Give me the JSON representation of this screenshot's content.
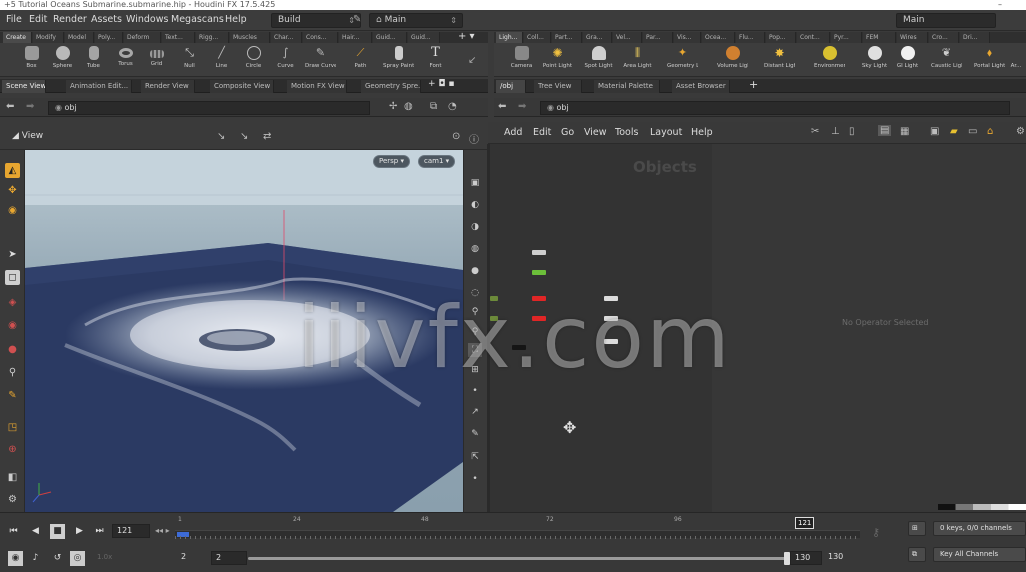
{
  "window": {
    "title": "+5 Tutorial Oceans Submarine.submarine.hip - Houdini FX 17.5.425",
    "minimize": "–"
  },
  "menubar": {
    "items": [
      "File",
      "Edit",
      "Render",
      "Assets",
      "Windows",
      "Megascans",
      "Help"
    ],
    "desktop_select": "Build",
    "main_select": "Main",
    "right_main": "Main"
  },
  "left_shelf": {
    "tabs": [
      "Create",
      "Modify",
      "Model",
      "Poly...",
      "Deform",
      "Text...",
      "Rigg...",
      "Muscles",
      "Char...",
      "Cons...",
      "Hair...",
      "Guid...",
      "Guid..."
    ],
    "tools": [
      "Box",
      "Sphere",
      "Tube",
      "Torus",
      "Grid",
      "Null",
      "Line",
      "Circle",
      "Curve",
      "Draw Curve",
      "Path",
      "Spray Paint",
      "Font"
    ]
  },
  "right_shelf": {
    "tabs": [
      "Ligh...",
      "Coll...",
      "Part...",
      "Gra...",
      "Vel...",
      "Par...",
      "Vis...",
      "Ocea...",
      "Flu...",
      "Pop...",
      "Cont...",
      "Pyr...",
      "FEM",
      "Wires",
      "Cro...",
      "Dri..."
    ],
    "tools": [
      "Camera",
      "Point Light",
      "Spot Light",
      "Area Light",
      "Geometry Light",
      "Volume Light",
      "Distant Light",
      "Environment Light",
      "Sky Light",
      "GI Light",
      "Caustic Light",
      "Portal Light",
      "Ar..."
    ]
  },
  "left_pane": {
    "tabs": [
      "Scene View",
      "Animation Edit...",
      "Render View",
      "Composite View",
      "Motion FX View",
      "Geometry Spre..."
    ],
    "path": "obj",
    "toolbar_label": "View",
    "persp": "Persp ▾",
    "cam": "cam1 ▾"
  },
  "right_pane": {
    "tabs": [
      "/obj",
      "Tree View",
      "Material Palette",
      "Asset Browser"
    ],
    "path": "obj",
    "menus": [
      "Add",
      "Edit",
      "Go",
      "View",
      "Tools",
      "Layout",
      "Help"
    ],
    "network_title": "Objects",
    "param_message": "No Operator Selected"
  },
  "timeline": {
    "frame_field": "121",
    "ticks": [
      "1",
      "24",
      "48",
      "72",
      "96",
      "121"
    ],
    "current_frame_marker": "121",
    "start": "2",
    "range_start": "2",
    "range_end": "130",
    "end": "130",
    "fps_label": "1.0x",
    "keys_label": "0 keys, 0/0 channels",
    "key_all": "Key All Channels"
  },
  "watermark": "iiivfx.com",
  "colors": {
    "ocean_plane": "#2b3a63",
    "accent_orange": "#e7a630",
    "node_red": "#e02626",
    "node_green": "#6cbf3a"
  }
}
